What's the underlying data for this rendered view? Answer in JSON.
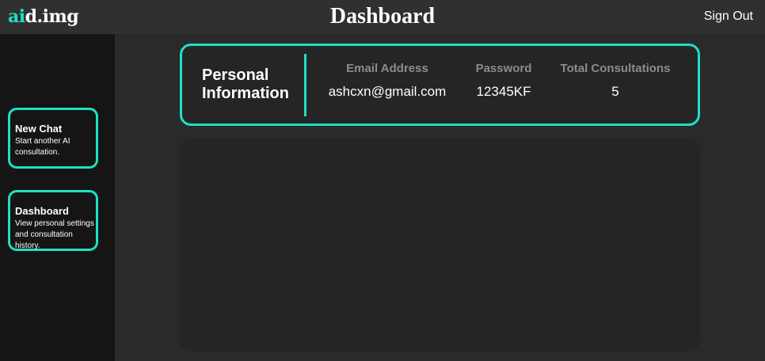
{
  "header": {
    "logo_accent": "ai",
    "logo_rest": "d.img",
    "title": "Dashboard",
    "sign_out_label": "Sign Out"
  },
  "sidebar": {
    "items": [
      {
        "title": "New Chat",
        "description": "Start another AI consultation."
      },
      {
        "title": "Dashboard",
        "description": "View personal settings and consultation history."
      }
    ]
  },
  "personal_info": {
    "title": "Personal Information",
    "fields": [
      {
        "label": "Email Address",
        "value": "ashcxn@gmail.com"
      },
      {
        "label": "Password",
        "value": "12345KF"
      },
      {
        "label": "Total Consultations",
        "value": "5"
      }
    ]
  },
  "colors": {
    "accent": "#1de0c4",
    "background": "#2a2a2a",
    "header": "#303030",
    "sidebar": "#151515",
    "card": "#252525",
    "label_gray": "#8c8c8c"
  }
}
